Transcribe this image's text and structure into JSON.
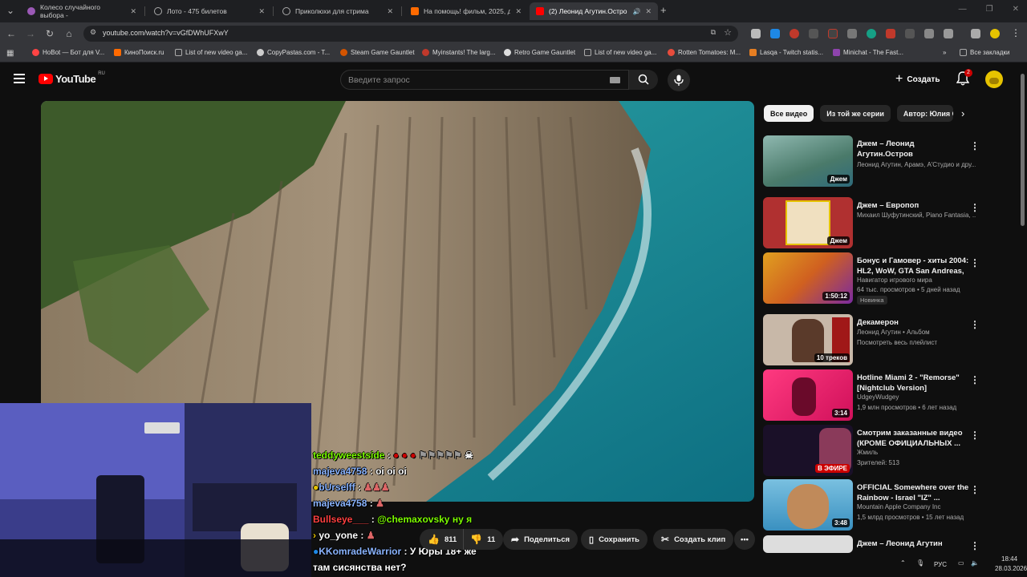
{
  "browser": {
    "tabs": [
      {
        "label": "Колесо случайного выбора - ",
        "color": "#9b59b6"
      },
      {
        "label": "Лото - 475 билетов",
        "color": "#aaaaaa"
      },
      {
        "label": "Приколюхи для стрима",
        "color": "#aaaaaa"
      },
      {
        "label": "На помощь! фильм, 2025, дат",
        "color": "#ff6a00"
      },
      {
        "label": "(2) Леонид Агутин.Остров",
        "color": "#ff0000"
      }
    ],
    "url": "youtube.com/watch?v=vGfDWhUFXwY",
    "bookmarks": [
      "HoBot — Бот для V...",
      "КиноПоиск.ru",
      "List of new video ga...",
      "CopyPastas.com - T...",
      "Steam Game Gauntlet",
      "Myinstants! The larg...",
      "Retro Game Gauntlet",
      "List of new video ga...",
      "Rotten Tomatoes: M...",
      "Lasqa - Twitch statis...",
      "Minichat - The Fast..."
    ],
    "all_bookmarks": "Все закладки"
  },
  "youtube": {
    "logo": "YouTube",
    "region": "RU",
    "search_placeholder": "Введите запрос",
    "create_label": "Создать",
    "notifications_count": "2"
  },
  "chat": [
    {
      "user": "teddyweestside",
      "text": "",
      "user_color": "#7cfc00"
    },
    {
      "user": "majeva4758",
      "text": "oi oi oi",
      "user_color": "#8ab4ff"
    },
    {
      "user": "bUrselff",
      "text": "",
      "user_color": "#8ab4ff"
    },
    {
      "user": "majeva4758",
      "text": "",
      "user_color": "#8ab4ff"
    },
    {
      "user": "Bullseye___",
      "text": "@chemaxovsky ну я",
      "user_color": "#ff4040"
    },
    {
      "user": "yo_yone",
      "text": "",
      "user_color": "#ffffff"
    },
    {
      "user": "KKomradeWarrior",
      "text": "У Юры 18+ же",
      "user_color": "#8ab4ff"
    },
    {
      "user": "",
      "text": "там сисянства нет?",
      "user_color": "#ffffff"
    }
  ],
  "video_actions": {
    "likes": "811",
    "dislikes": "11",
    "share": "Поделиться",
    "save": "Сохранить",
    "clip": "Создать клип"
  },
  "chips": [
    "Все видео",
    "Из той же серии",
    "Автор: Юлия С"
  ],
  "recommendations": [
    {
      "title": "Джем – Леонид Агутин.Остров",
      "meta1": "Леонид Агутин, Арамэ, А'Студио и дру...",
      "meta2": "",
      "badge": "Джем",
      "thumb": "#4a7a6a"
    },
    {
      "title": "Джем – Европоп",
      "meta1": "Михаил Шуфутинский, Piano Fantasia, ...",
      "meta2": "",
      "badge": "Джем",
      "thumb": "#b03030"
    },
    {
      "title": "Бонус и Гамовер - хиты 2004: HL2, WoW, GTA San Andreas, ...",
      "meta1": "Навигатор игрового мира",
      "meta2": "64 тыс. просмотров • 5 дней назад",
      "badge": "1:50:12",
      "new": "Новинка",
      "thumb": "#d08020"
    },
    {
      "title": "Декамерон",
      "meta1": "Леонид Агутин • Альбом",
      "meta2": "Посмотреть весь плейлист",
      "badge": "10 треков",
      "thumb": "#8a6a5a"
    },
    {
      "title": "Hotline Miami 2 - \"Remorse\" [Nightclub Version]",
      "meta1": "UdgeyWudgey",
      "meta2": "1,9 млн просмотров • 6 лет назад",
      "badge": "3:14",
      "thumb": "#e0206a"
    },
    {
      "title": "Смотрим заказанные видео (КРОМЕ ОФИЦИАЛЬНЫХ ...",
      "meta1": "Жмиль",
      "meta2": "Зрителей: 513",
      "badge": "В ЭФИРЕ",
      "live": true,
      "thumb": "#2a1a3a"
    },
    {
      "title": "OFFICIAL Somewhere over the Rainbow - Israel \"IZ\" ...",
      "meta1": "Mountain Apple Company Inc",
      "meta2": "1,5 млрд просмотров • 15 лет назад",
      "badge": "3:48",
      "thumb": "#3a90c0"
    },
    {
      "title": "Джем – Леонид Агутин",
      "meta1": "",
      "meta2": "",
      "badge": "",
      "thumb": "#dddddd"
    }
  ],
  "taskbar": {
    "lang": "РУС",
    "time": "18:44",
    "date": "28.03.2026"
  }
}
